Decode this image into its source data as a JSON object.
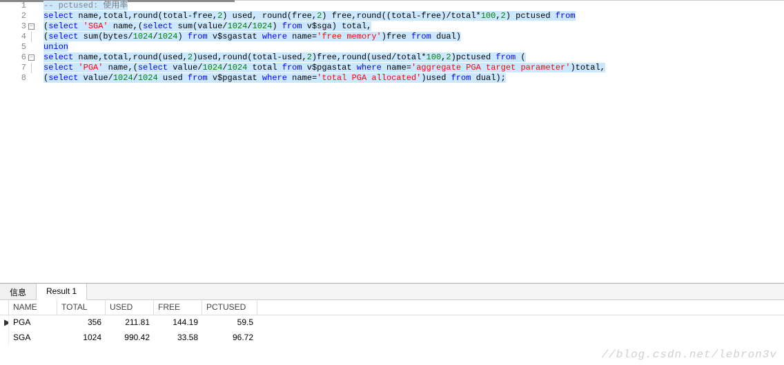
{
  "editor": {
    "lines": [
      {
        "num": "1",
        "fold": "",
        "tokens": [
          {
            "t": "cmt",
            "s": "-- pctused: 使用率",
            "hl": true
          }
        ]
      },
      {
        "num": "2",
        "fold": "",
        "tokens": [
          {
            "t": "kw",
            "s": "select",
            "hl": true
          },
          {
            "t": "ident",
            "s": " name,total,round(total-free,",
            "hl": true
          },
          {
            "t": "num",
            "s": "2",
            "hl": true
          },
          {
            "t": "ident",
            "s": ") used, round(free,",
            "hl": true
          },
          {
            "t": "num",
            "s": "2",
            "hl": true
          },
          {
            "t": "ident",
            "s": ") free,round((total-free)/total*",
            "hl": true
          },
          {
            "t": "num",
            "s": "100",
            "hl": true
          },
          {
            "t": "ident",
            "s": ",",
            "hl": true
          },
          {
            "t": "num",
            "s": "2",
            "hl": true
          },
          {
            "t": "ident",
            "s": ") pctused ",
            "hl": true
          },
          {
            "t": "kw",
            "s": "from",
            "hl": true
          }
        ]
      },
      {
        "num": "3",
        "fold": "minus",
        "tokens": [
          {
            "t": "ident",
            "s": "(",
            "hl": true
          },
          {
            "t": "kw",
            "s": "select",
            "hl": true
          },
          {
            "t": "ident",
            "s": " ",
            "hl": true
          },
          {
            "t": "str",
            "s": "'SGA'",
            "hl": true
          },
          {
            "t": "ident",
            "s": " name,(",
            "hl": true
          },
          {
            "t": "kw",
            "s": "select",
            "hl": true
          },
          {
            "t": "ident",
            "s": " sum(value/",
            "hl": true
          },
          {
            "t": "num",
            "s": "1024",
            "hl": true
          },
          {
            "t": "ident",
            "s": "/",
            "hl": true
          },
          {
            "t": "num",
            "s": "1024",
            "hl": true
          },
          {
            "t": "ident",
            "s": ") ",
            "hl": true
          },
          {
            "t": "kw",
            "s": "from",
            "hl": true
          },
          {
            "t": "ident",
            "s": " v$sga) total,",
            "hl": true
          }
        ]
      },
      {
        "num": "4",
        "fold": "line",
        "tokens": [
          {
            "t": "ident",
            "s": "(",
            "hl": true
          },
          {
            "t": "kw",
            "s": "select",
            "hl": true
          },
          {
            "t": "ident",
            "s": " sum(bytes/",
            "hl": true
          },
          {
            "t": "num",
            "s": "1024",
            "hl": true
          },
          {
            "t": "ident",
            "s": "/",
            "hl": true
          },
          {
            "t": "num",
            "s": "1024",
            "hl": true
          },
          {
            "t": "ident",
            "s": ") ",
            "hl": true
          },
          {
            "t": "kw",
            "s": "from",
            "hl": true
          },
          {
            "t": "ident",
            "s": " v$sgastat ",
            "hl": true
          },
          {
            "t": "kw",
            "s": "where",
            "hl": true
          },
          {
            "t": "ident",
            "s": " name=",
            "hl": true
          },
          {
            "t": "str",
            "s": "'free memory'",
            "hl": true
          },
          {
            "t": "ident",
            "s": ")free ",
            "hl": true
          },
          {
            "t": "kw",
            "s": "from",
            "hl": true
          },
          {
            "t": "ident",
            "s": " dual)",
            "hl": true
          }
        ]
      },
      {
        "num": "5",
        "fold": "",
        "tokens": [
          {
            "t": "kw",
            "s": "union",
            "hl": true
          }
        ]
      },
      {
        "num": "6",
        "fold": "minus",
        "tokens": [
          {
            "t": "kw",
            "s": "select",
            "hl": true
          },
          {
            "t": "ident",
            "s": " name,total,round(used,",
            "hl": true
          },
          {
            "t": "num",
            "s": "2",
            "hl": true
          },
          {
            "t": "ident",
            "s": ")used,round(total-used,",
            "hl": true
          },
          {
            "t": "num",
            "s": "2",
            "hl": true
          },
          {
            "t": "ident",
            "s": ")free,round(used/total*",
            "hl": true
          },
          {
            "t": "num",
            "s": "100",
            "hl": true
          },
          {
            "t": "ident",
            "s": ",",
            "hl": true
          },
          {
            "t": "num",
            "s": "2",
            "hl": true
          },
          {
            "t": "ident",
            "s": ")pctused ",
            "hl": true
          },
          {
            "t": "kw",
            "s": "from",
            "hl": true
          },
          {
            "t": "ident",
            "s": " (",
            "hl": true
          }
        ]
      },
      {
        "num": "7",
        "fold": "line",
        "tokens": [
          {
            "t": "kw",
            "s": "select",
            "hl": true
          },
          {
            "t": "ident",
            "s": " ",
            "hl": true
          },
          {
            "t": "str",
            "s": "'PGA'",
            "hl": true
          },
          {
            "t": "ident",
            "s": " name,(",
            "hl": true
          },
          {
            "t": "kw",
            "s": "select",
            "hl": true
          },
          {
            "t": "ident",
            "s": " value/",
            "hl": true
          },
          {
            "t": "num",
            "s": "1024",
            "hl": true
          },
          {
            "t": "ident",
            "s": "/",
            "hl": true
          },
          {
            "t": "num",
            "s": "1024",
            "hl": true
          },
          {
            "t": "ident",
            "s": " total ",
            "hl": true
          },
          {
            "t": "kw",
            "s": "from",
            "hl": true
          },
          {
            "t": "ident",
            "s": " v$pgastat ",
            "hl": true
          },
          {
            "t": "kw",
            "s": "where",
            "hl": true
          },
          {
            "t": "ident",
            "s": " name=",
            "hl": true
          },
          {
            "t": "str",
            "s": "'aggregate PGA target parameter'",
            "hl": true
          },
          {
            "t": "ident",
            "s": ")total,",
            "hl": true
          }
        ]
      },
      {
        "num": "8",
        "fold": "",
        "tokens": [
          {
            "t": "ident",
            "s": "(",
            "hl": true
          },
          {
            "t": "kw",
            "s": "select",
            "hl": true
          },
          {
            "t": "ident",
            "s": " value/",
            "hl": true
          },
          {
            "t": "num",
            "s": "1024",
            "hl": true
          },
          {
            "t": "ident",
            "s": "/",
            "hl": true
          },
          {
            "t": "num",
            "s": "1024",
            "hl": true
          },
          {
            "t": "ident",
            "s": " used ",
            "hl": true
          },
          {
            "t": "kw",
            "s": "from",
            "hl": true
          },
          {
            "t": "ident",
            "s": " v$pgastat ",
            "hl": true
          },
          {
            "t": "kw",
            "s": "where",
            "hl": true
          },
          {
            "t": "ident",
            "s": " name=",
            "hl": true
          },
          {
            "t": "str",
            "s": "'total PGA allocated'",
            "hl": true
          },
          {
            "t": "ident",
            "s": ")used ",
            "hl": true
          },
          {
            "t": "kw",
            "s": "from",
            "hl": true
          },
          {
            "t": "ident",
            "s": " dual);",
            "hl": true
          }
        ]
      }
    ]
  },
  "tabs": {
    "info": "信息",
    "result1": "Result 1"
  },
  "grid": {
    "headers": {
      "name": "NAME",
      "total": "TOTAL",
      "used": "USED",
      "free": "FREE",
      "pctused": "PCTUSED"
    },
    "rows": [
      {
        "indicator": "▶",
        "name": "PGA",
        "total": "356",
        "used": "211.81",
        "free": "144.19",
        "pctused": "59.5"
      },
      {
        "indicator": "",
        "name": "SGA",
        "total": "1024",
        "used": "990.42",
        "free": "33.58",
        "pctused": "96.72"
      }
    ]
  },
  "watermark": "//blog.csdn.net/lebron3v"
}
